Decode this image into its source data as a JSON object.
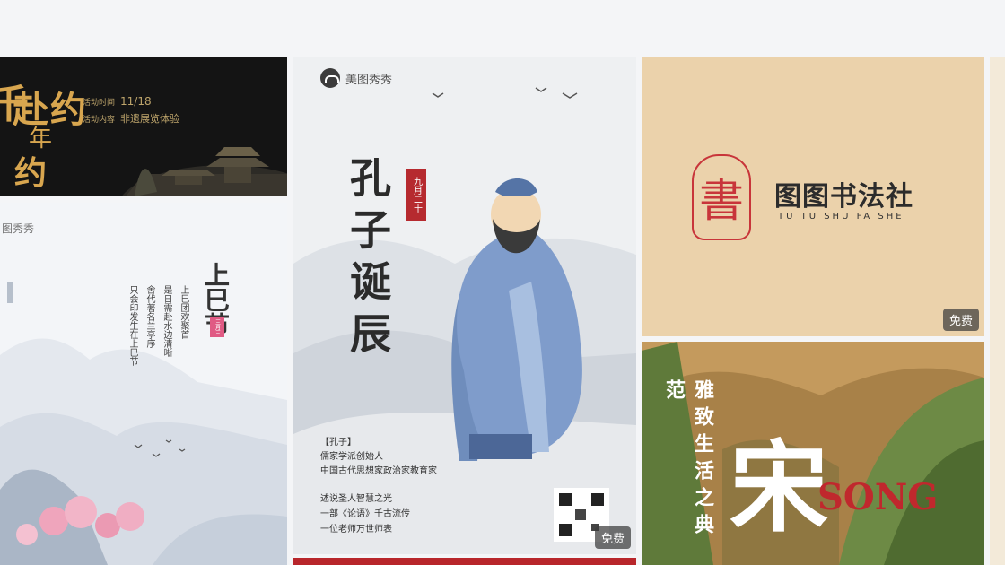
{
  "tags": {
    "free": "免费"
  },
  "card1": {
    "title": "赴约",
    "title_left": "千",
    "title_chars": [
      "年",
      "约"
    ],
    "date_label": "活动时间",
    "date_value": "11/18",
    "place_label": "活动内容",
    "place_value": "非遗展览体验"
  },
  "card2": {
    "brand": "图秀秀",
    "title": "上巳节",
    "seal": "三月三",
    "poem_cols": [
      "上巳团欢聚首",
      "是日需赴水边清晰",
      "舍代著名兰亭序",
      "只会印发生在上巳节"
    ]
  },
  "card3": {
    "brand": "美图秀秀",
    "title": "孔子诞辰",
    "seal": "九月二十",
    "bio_head": "【孔子】",
    "bio_lines": [
      "儒家学派创始人",
      "中国古代思想家政治家教育家"
    ],
    "quote_lines": [
      "述说圣人智慧之光",
      "一部《论语》千古流传",
      "一位老师万世师表"
    ],
    "tag": "免费"
  },
  "card4": {
    "seal_char": "書",
    "name": "图图书法社",
    "pinyin": "TU TU SHU FA SHE",
    "tag": "免费"
  },
  "card5": {
    "vertical_text": "雅致生活之典范",
    "big_char": "宋",
    "song": "SONG"
  },
  "colors": {
    "background": "#f4f5f7",
    "tag_bg": "#3c3c3c",
    "seal_red": "#c0282d"
  }
}
